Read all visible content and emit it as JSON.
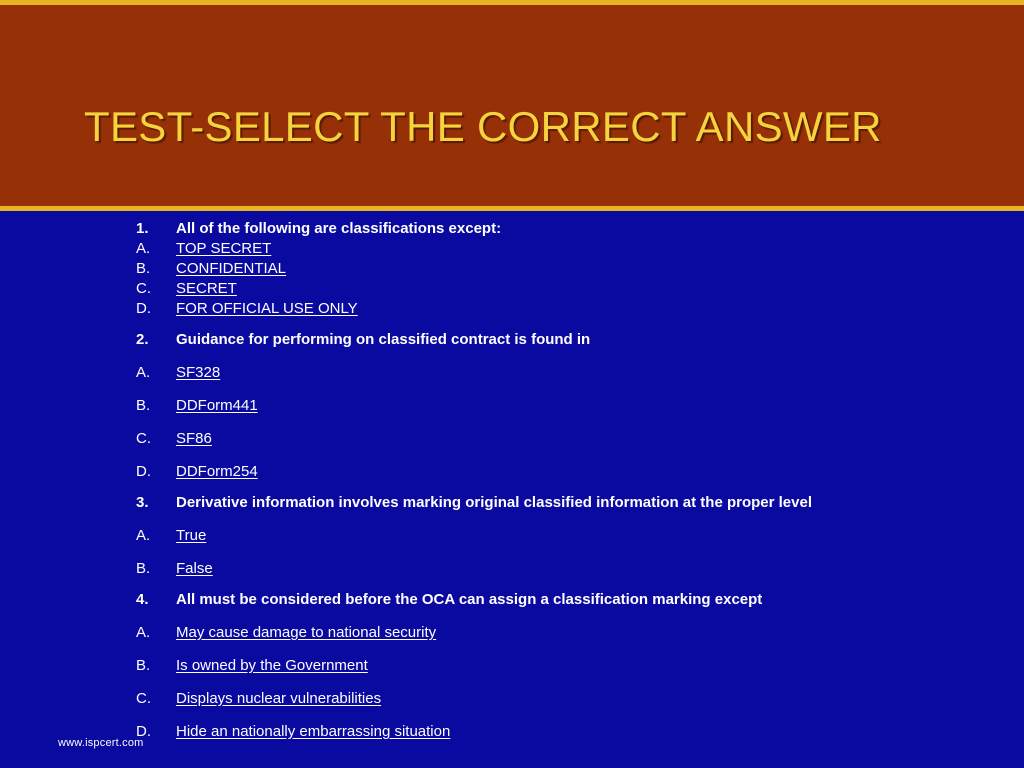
{
  "theme": {
    "header_bg": "#963006",
    "body_bg": "#0a0aa0",
    "accent_rule": "#e8b422",
    "title_color": "#f5d33c",
    "text_color": "#ffffff"
  },
  "header": {
    "title": "TEST-SELECT THE CORRECT ANSWER"
  },
  "footer": {
    "url": "www.ispcert.com"
  },
  "quiz": {
    "questions": [
      {
        "number": "1.",
        "prompt": "All of the following are classifications except:",
        "spacing": "compact",
        "options": [
          {
            "letter": "A.",
            "text": "TOP SECRET"
          },
          {
            "letter": "B.",
            "text": "CONFIDENTIAL"
          },
          {
            "letter": "C.",
            "text": "SECRET"
          },
          {
            "letter": "D.",
            "text": "FOR OFFICIAL USE ONLY"
          }
        ]
      },
      {
        "number": "2.",
        "prompt": "Guidance for performing on classified contract is found in",
        "spacing": "roomy",
        "options": [
          {
            "letter": "A.",
            "text": "SF328"
          },
          {
            "letter": "B.",
            "text": "DDForm441"
          },
          {
            "letter": "C.",
            "text": "SF86"
          },
          {
            "letter": "D.",
            "text": "DDForm254"
          }
        ]
      },
      {
        "number": "3.",
        "prompt": "Derivative information involves marking original classified information at the proper level",
        "spacing": "roomy",
        "options": [
          {
            "letter": "A.",
            "text": "True"
          },
          {
            "letter": "B.",
            "text": "False"
          }
        ]
      },
      {
        "number": "4.",
        "prompt": "All must be considered before the OCA can assign a classification marking except",
        "spacing": "roomy",
        "options": [
          {
            "letter": "A.",
            "text": "May cause damage to national security"
          },
          {
            "letter": "B.",
            "text": "Is owned by the Government"
          },
          {
            "letter": "C.",
            "text": "Displays nuclear vulnerabilities"
          },
          {
            "letter": "D.",
            "text": "Hide an nationally embarrassing situation"
          }
        ]
      }
    ]
  }
}
